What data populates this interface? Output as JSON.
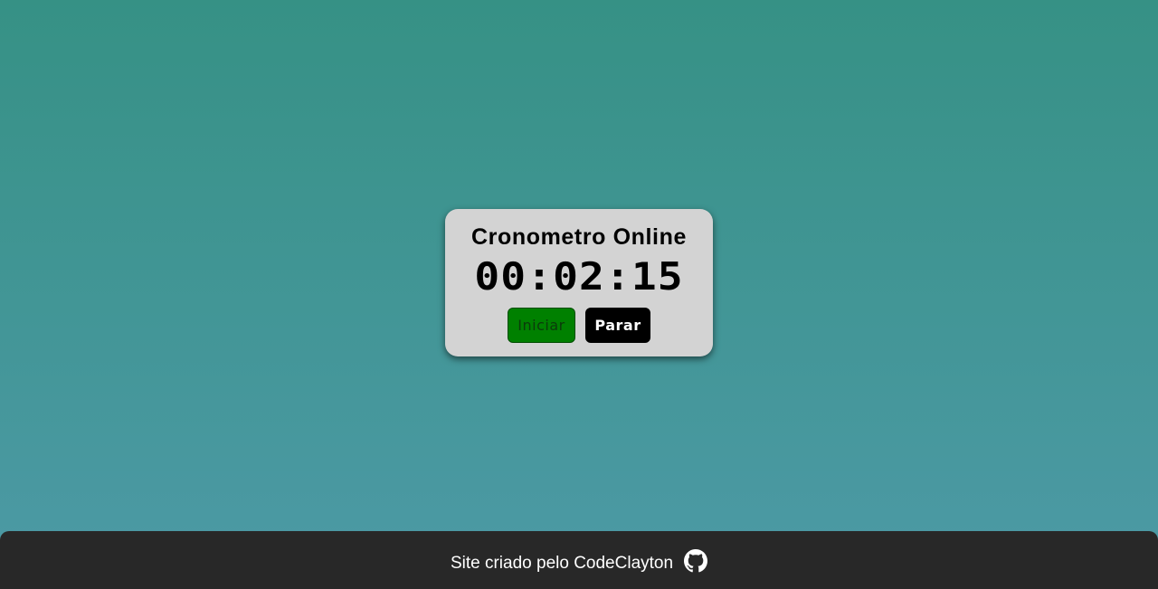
{
  "timer": {
    "title": "Cronometro Online",
    "display": "00:02:15",
    "start_label": "Iniciar",
    "stop_label": "Parar"
  },
  "footer": {
    "text": "Site criado pelo CodeClayton",
    "icon": "github-icon"
  },
  "colors": {
    "background_top": "#369185",
    "background_bottom": "#4d9aa6",
    "card": "#d3d3d3",
    "start_button": "#008000",
    "stop_button": "#000000",
    "footer": "#282828"
  }
}
